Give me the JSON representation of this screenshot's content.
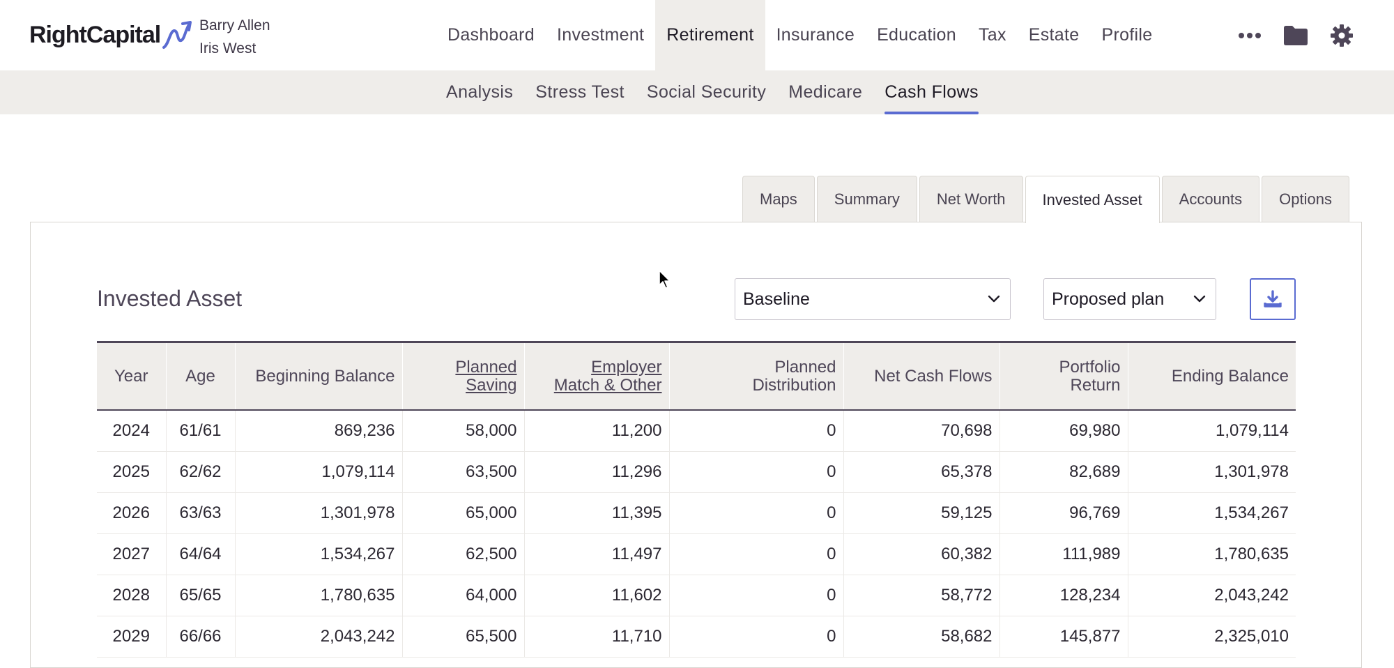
{
  "header": {
    "logo_text": "RightCapital",
    "clients": [
      "Barry Allen",
      "Iris West"
    ],
    "nav": [
      "Dashboard",
      "Investment",
      "Retirement",
      "Insurance",
      "Education",
      "Tax",
      "Estate",
      "Profile"
    ],
    "active_nav": "Retirement",
    "icons": [
      "more-icon",
      "folder-icon",
      "gear-icon"
    ]
  },
  "subnav": {
    "items": [
      "Analysis",
      "Stress Test",
      "Social Security",
      "Medicare",
      "Cash Flows"
    ],
    "active": "Cash Flows"
  },
  "tabs": {
    "items": [
      "Maps",
      "Summary",
      "Net Worth",
      "Invested Asset",
      "Accounts",
      "Options"
    ],
    "active": "Invested Asset"
  },
  "section": {
    "title": "Invested Asset",
    "scenario_select": "Baseline",
    "plan_select": "Proposed plan"
  },
  "table": {
    "headers": {
      "year": "Year",
      "age": "Age",
      "beginning": "Beginning Balance",
      "planned_saving": [
        "Planned",
        "Saving"
      ],
      "employer": [
        "Employer",
        "Match & Other"
      ],
      "planned_dist": [
        "Planned",
        "Distribution"
      ],
      "net_cash": "Net Cash Flows",
      "portfolio_return": [
        "Portfolio",
        "Return"
      ],
      "ending": "Ending Balance"
    },
    "rows": [
      [
        "2024",
        "61/61",
        "869,236",
        "58,000",
        "11,200",
        "0",
        "70,698",
        "69,980",
        "1,079,114"
      ],
      [
        "2025",
        "62/62",
        "1,079,114",
        "63,500",
        "11,296",
        "0",
        "65,378",
        "82,689",
        "1,301,978"
      ],
      [
        "2026",
        "63/63",
        "1,301,978",
        "65,000",
        "11,395",
        "0",
        "59,125",
        "96,769",
        "1,534,267"
      ],
      [
        "2027",
        "64/64",
        "1,534,267",
        "62,500",
        "11,497",
        "0",
        "60,382",
        "111,989",
        "1,780,635"
      ],
      [
        "2028",
        "65/65",
        "1,780,635",
        "64,000",
        "11,602",
        "0",
        "58,772",
        "128,234",
        "2,043,242"
      ],
      [
        "2029",
        "66/66",
        "2,043,242",
        "65,500",
        "11,710",
        "0",
        "58,682",
        "145,877",
        "2,325,010"
      ]
    ]
  },
  "colors": {
    "accent": "#5a6bd1",
    "nav_bg": "#efedea",
    "text": "#3d3646"
  }
}
